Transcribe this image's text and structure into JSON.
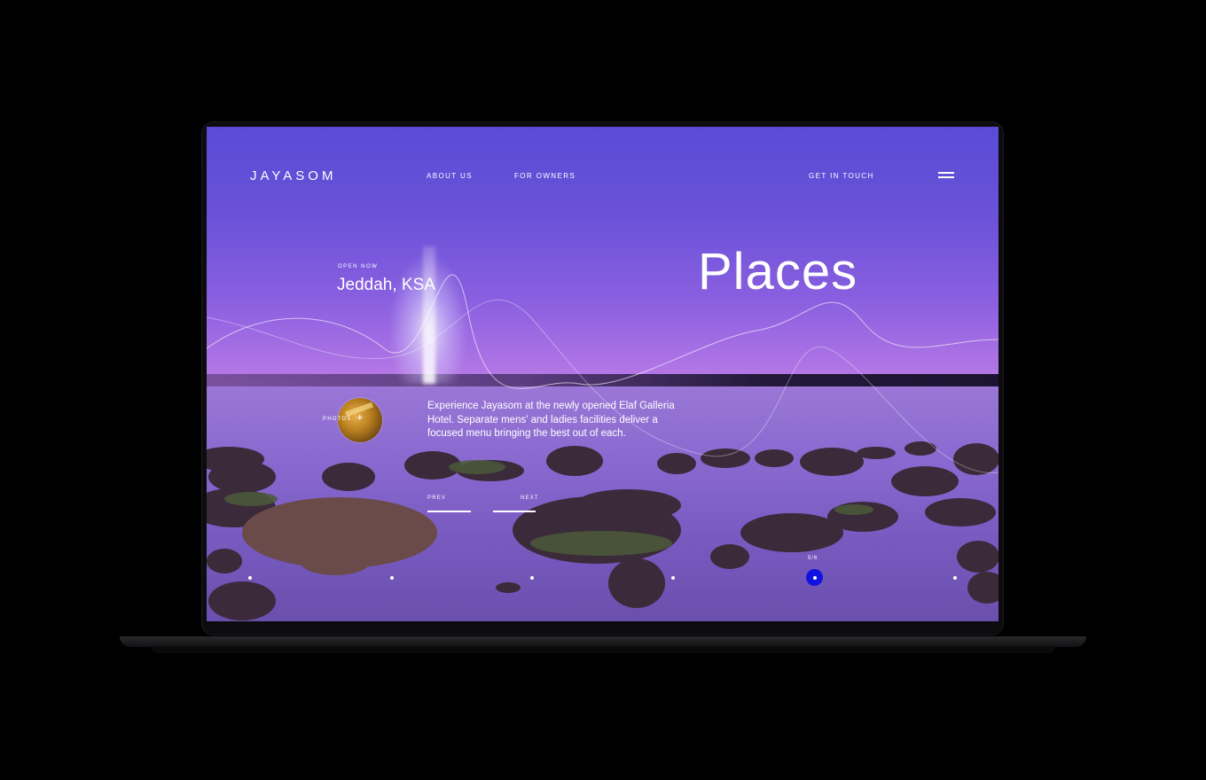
{
  "header": {
    "brand": "JAYASOM",
    "nav": [
      "ABOUT US",
      "FOR OWNERS"
    ],
    "cta": "GET IN TOUCH"
  },
  "hero": {
    "eyebrow": "OPEN NOW",
    "location": "Jeddah, KSA",
    "title": "Places",
    "photos_label": "PHOTOS",
    "photos_icon": "plus-icon",
    "description": "Experience Jayasom at the newly opened Elaf Galleria Hotel. Separate mens' and ladies facilities deliver a focused menu bringing the best out of each.",
    "prev_label": "PREV",
    "next_label": "NEXT"
  },
  "slider": {
    "current_label": "5/6",
    "total": 6,
    "active_index": 5
  },
  "colors": {
    "accent": "#1212e0",
    "text": "#ffffff",
    "background": "#000000"
  }
}
